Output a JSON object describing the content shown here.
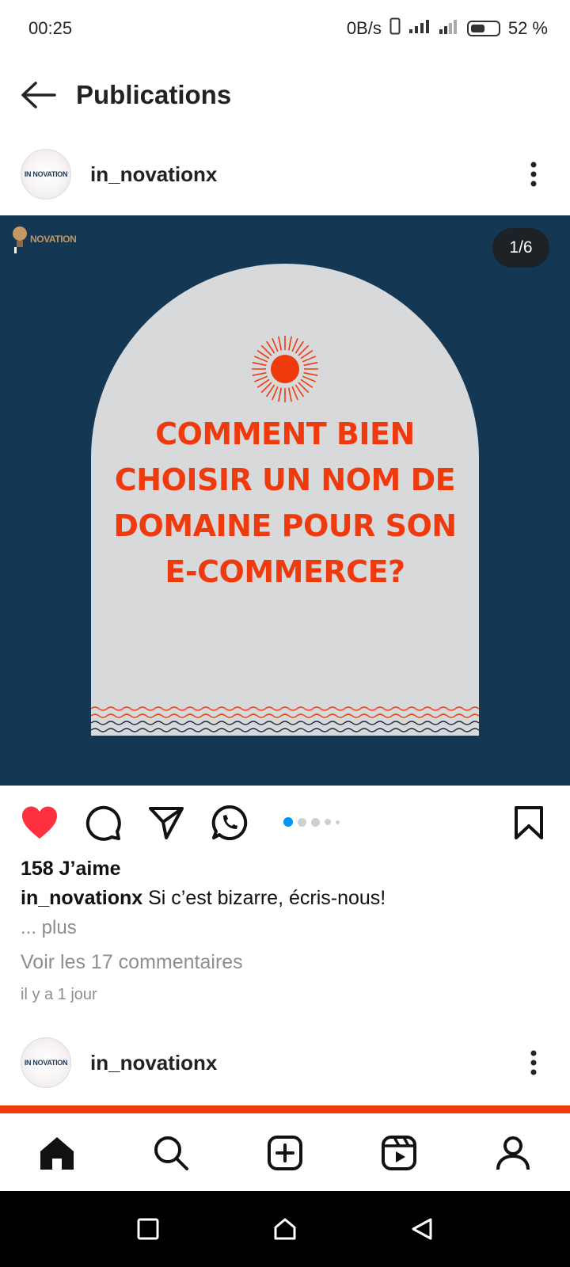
{
  "status": {
    "time": "00:25",
    "network_speed": "0B/s",
    "battery_percent": "52 %",
    "battery_level": 0.52
  },
  "header": {
    "title": "Publications"
  },
  "post": {
    "username": "in_novationx",
    "avatar_text": "IN NOVATION",
    "image": {
      "brand_text": "NOVATION",
      "counter": "1/6",
      "headline_lines": [
        "COMMENT BIEN",
        "CHOISIR UN NOM DE",
        "DOMAINE POUR SON",
        "E-COMMERCE?"
      ],
      "background_color": "#143754",
      "accent_color": "#ef3a0e"
    },
    "liked": true,
    "likes_text": "158 J’aime",
    "caption_user": "in_novationx",
    "caption_text": " Si c’est bizarre, écris-nous!",
    "more_text": "... plus",
    "comments_text": "Voir les 17 commentaires",
    "timestamp": "il y a 1 jour",
    "carousel": {
      "total_dots": 5,
      "active_index": 0
    }
  },
  "next_post": {
    "username": "in_novationx",
    "avatar_text": "IN NOVATION"
  },
  "icons": {
    "like": "heart-icon",
    "comment": "comment-icon",
    "share": "send-icon",
    "whatsapp": "whatsapp-icon",
    "save": "bookmark-icon"
  },
  "nav": {
    "items": [
      "home-icon",
      "search-icon",
      "create-icon",
      "reels-icon",
      "profile-icon"
    ]
  }
}
